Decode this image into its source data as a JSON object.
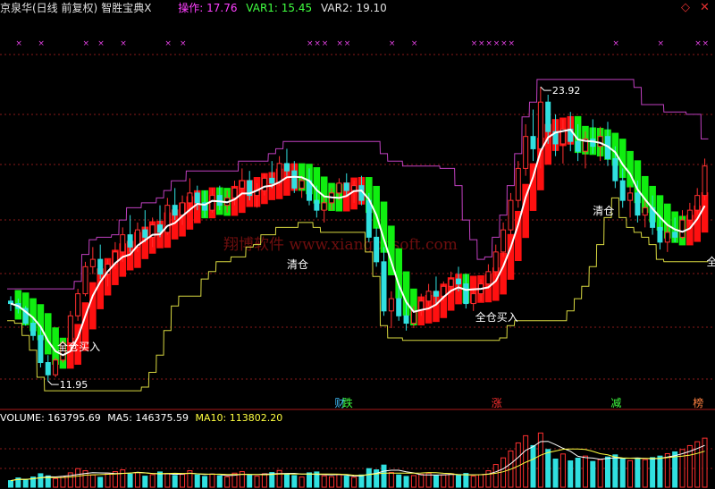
{
  "header": {
    "stock_name": "京泉华(日线 前复权)",
    "indicator_name": "智胜宝典X",
    "op_label": "操作: ",
    "op_value": "17.76",
    "var1_label": "VAR1: ",
    "var1_value": "15.45",
    "var2_label": "VAR2: ",
    "var2_value": "19.10",
    "colors": {
      "name": "#e0e0e0",
      "op": "#ff40ff",
      "var1": "#40ff40",
      "var2": "#e0e0e0"
    }
  },
  "corner_icons": [
    "diamond-icon",
    "close-icon"
  ],
  "volume_header": {
    "volume_label": "VOLUME: ",
    "volume_value": "163795.69",
    "ma5_label": "MA5: ",
    "ma5_value": "146375.59",
    "ma10_label": "MA10: ",
    "ma10_value": "113802.20"
  },
  "watermark": "翔博软件 www.xiangbosoft.com",
  "chart_data": {
    "type": "candlestick",
    "price_range": [
      10.9,
      26.0
    ],
    "high_label": "23.92",
    "low_label": "11.95",
    "candles": [
      [
        15.2,
        15.4,
        14.8,
        15.1
      ],
      [
        15.1,
        15.3,
        14.7,
        14.9
      ],
      [
        14.9,
        15.0,
        14.2,
        14.3
      ],
      [
        14.3,
        14.5,
        13.6,
        13.8
      ],
      [
        13.8,
        14.1,
        12.5,
        12.7
      ],
      [
        12.7,
        13.0,
        11.95,
        12.2
      ],
      [
        12.2,
        12.9,
        12.1,
        12.8
      ],
      [
        12.8,
        13.6,
        12.7,
        13.5
      ],
      [
        13.5,
        14.8,
        13.4,
        14.6
      ],
      [
        14.6,
        15.7,
        14.4,
        15.5
      ],
      [
        15.5,
        16.8,
        15.4,
        16.6
      ],
      [
        16.6,
        17.4,
        16.3,
        16.9
      ],
      [
        16.9,
        17.5,
        16.1,
        16.3
      ],
      [
        16.3,
        16.9,
        15.8,
        16.7
      ],
      [
        16.7,
        17.6,
        16.5,
        17.2
      ],
      [
        17.2,
        18.2,
        16.8,
        17.9
      ],
      [
        17.9,
        18.7,
        17.2,
        17.4
      ],
      [
        17.4,
        18.4,
        17.2,
        18.1
      ],
      [
        18.1,
        18.9,
        17.6,
        17.8
      ],
      [
        17.8,
        18.6,
        17.4,
        18.3
      ],
      [
        18.3,
        19.1,
        17.8,
        18.0
      ],
      [
        18.0,
        19.4,
        17.9,
        19.1
      ],
      [
        19.1,
        19.8,
        18.5,
        18.7
      ],
      [
        18.7,
        19.5,
        18.3,
        19.2
      ],
      [
        19.2,
        20.2,
        18.8,
        19.6
      ],
      [
        19.6,
        19.9,
        18.9,
        19.2
      ],
      [
        19.2,
        19.7,
        18.6,
        18.9
      ],
      [
        18.9,
        19.8,
        18.8,
        19.5
      ],
      [
        19.5,
        19.9,
        18.9,
        19.1
      ],
      [
        19.1,
        19.7,
        18.8,
        19.4
      ],
      [
        19.4,
        20.1,
        19.1,
        19.8
      ],
      [
        19.8,
        20.6,
        19.5,
        20.1
      ],
      [
        20.1,
        20.5,
        19.3,
        19.5
      ],
      [
        19.5,
        20.0,
        19.0,
        19.7
      ],
      [
        19.7,
        20.4,
        19.5,
        20.2
      ],
      [
        20.2,
        20.9,
        19.8,
        20.0
      ],
      [
        20.0,
        21.1,
        19.9,
        20.8
      ],
      [
        20.8,
        21.4,
        20.3,
        20.5
      ],
      [
        20.5,
        20.9,
        19.6,
        19.8
      ],
      [
        19.8,
        20.3,
        19.4,
        20.1
      ],
      [
        20.1,
        20.6,
        19.1,
        19.3
      ],
      [
        19.3,
        19.9,
        18.6,
        18.9
      ],
      [
        18.9,
        19.4,
        18.4,
        19.2
      ],
      [
        19.2,
        19.8,
        18.9,
        19.6
      ],
      [
        19.6,
        20.2,
        19.3,
        20.0
      ],
      [
        20.0,
        20.4,
        19.5,
        19.7
      ],
      [
        19.7,
        20.1,
        19.2,
        19.9
      ],
      [
        19.9,
        20.3,
        19.1,
        19.3
      ],
      [
        19.3,
        19.6,
        17.6,
        17.8
      ],
      [
        17.8,
        18.2,
        16.6,
        16.8
      ],
      [
        16.8,
        17.4,
        14.6,
        14.8
      ],
      [
        14.8,
        15.6,
        14.1,
        15.3
      ],
      [
        15.3,
        15.9,
        14.4,
        14.6
      ],
      [
        14.6,
        15.2,
        14.0,
        14.3
      ],
      [
        14.3,
        15.0,
        14.1,
        14.8
      ],
      [
        14.8,
        15.5,
        14.6,
        15.2
      ],
      [
        15.2,
        15.9,
        15.0,
        15.6
      ],
      [
        15.6,
        16.2,
        15.1,
        15.4
      ],
      [
        15.4,
        16.0,
        15.2,
        15.8
      ],
      [
        15.8,
        16.4,
        15.5,
        16.1
      ],
      [
        16.1,
        16.6,
        15.6,
        15.9
      ],
      [
        15.9,
        16.3,
        14.9,
        15.1
      ],
      [
        15.1,
        15.7,
        14.8,
        15.5
      ],
      [
        15.5,
        16.1,
        15.2,
        15.9
      ],
      [
        15.9,
        16.7,
        15.7,
        16.4
      ],
      [
        16.4,
        17.5,
        16.2,
        17.2
      ],
      [
        17.2,
        18.4,
        17.0,
        18.1
      ],
      [
        18.1,
        19.6,
        17.9,
        19.3
      ],
      [
        19.3,
        20.9,
        19.0,
        20.6
      ],
      [
        20.6,
        22.4,
        20.3,
        21.9
      ],
      [
        21.9,
        23.0,
        20.9,
        21.4
      ],
      [
        21.4,
        23.92,
        20.6,
        23.3
      ],
      [
        23.3,
        23.6,
        21.6,
        22.1
      ],
      [
        22.1,
        22.8,
        21.1,
        21.6
      ],
      [
        21.6,
        22.6,
        20.8,
        22.2
      ],
      [
        22.2,
        22.9,
        21.3,
        21.7
      ],
      [
        21.7,
        22.4,
        20.9,
        21.3
      ],
      [
        21.3,
        22.1,
        20.6,
        21.8
      ],
      [
        21.8,
        22.6,
        21.2,
        21.5
      ],
      [
        21.5,
        22.3,
        20.9,
        21.9
      ],
      [
        21.9,
        22.5,
        20.7,
        21.0
      ],
      [
        21.0,
        21.5,
        19.8,
        20.1
      ],
      [
        20.1,
        20.6,
        19.0,
        19.3
      ],
      [
        19.3,
        19.9,
        18.6,
        19.6
      ],
      [
        19.6,
        20.1,
        18.4,
        18.7
      ],
      [
        18.7,
        19.3,
        18.2,
        19.0
      ],
      [
        19.0,
        19.5,
        17.9,
        18.2
      ],
      [
        18.2,
        18.7,
        17.3,
        17.6
      ],
      [
        17.6,
        18.3,
        17.2,
        18.0
      ],
      [
        18.0,
        18.6,
        17.6,
        17.8
      ],
      [
        17.8,
        18.9,
        17.7,
        18.5
      ],
      [
        18.5,
        19.2,
        18.3,
        18.9
      ],
      [
        18.9,
        19.8,
        18.7,
        19.5
      ],
      [
        19.5,
        21.0,
        19.3,
        20.7
      ]
    ],
    "volume_range": [
      0,
      200000
    ],
    "volumes": [
      22000,
      31000,
      26000,
      34000,
      45000,
      38000,
      29000,
      36000,
      48000,
      62000,
      55000,
      41000,
      33000,
      47000,
      52000,
      58000,
      44000,
      49000,
      37000,
      42000,
      51000,
      46000,
      39000,
      43000,
      55000,
      41000,
      36000,
      44000,
      38000,
      35000,
      47000,
      52000,
      40000,
      37000,
      45000,
      49000,
      56000,
      43000,
      39000,
      34000,
      48000,
      51000,
      38000,
      35000,
      42000,
      37000,
      33000,
      41000,
      62000,
      58000,
      74000,
      49000,
      41000,
      36000,
      39000,
      43000,
      47000,
      38000,
      41000,
      45000,
      39000,
      46000,
      37000,
      42000,
      55000,
      76000,
      98000,
      121000,
      148000,
      172000,
      139000,
      181000,
      126000,
      94000,
      111000,
      88000,
      97000,
      104000,
      86000,
      92000,
      101000,
      108000,
      95000,
      89000,
      97000,
      92000,
      99000,
      104000,
      112000,
      118000,
      126000,
      139000,
      152000,
      163795
    ],
    "markers": [
      "财",
      "跌",
      "涨",
      "减",
      "榜"
    ],
    "signals": [
      "全仓买入",
      "清仓"
    ]
  }
}
